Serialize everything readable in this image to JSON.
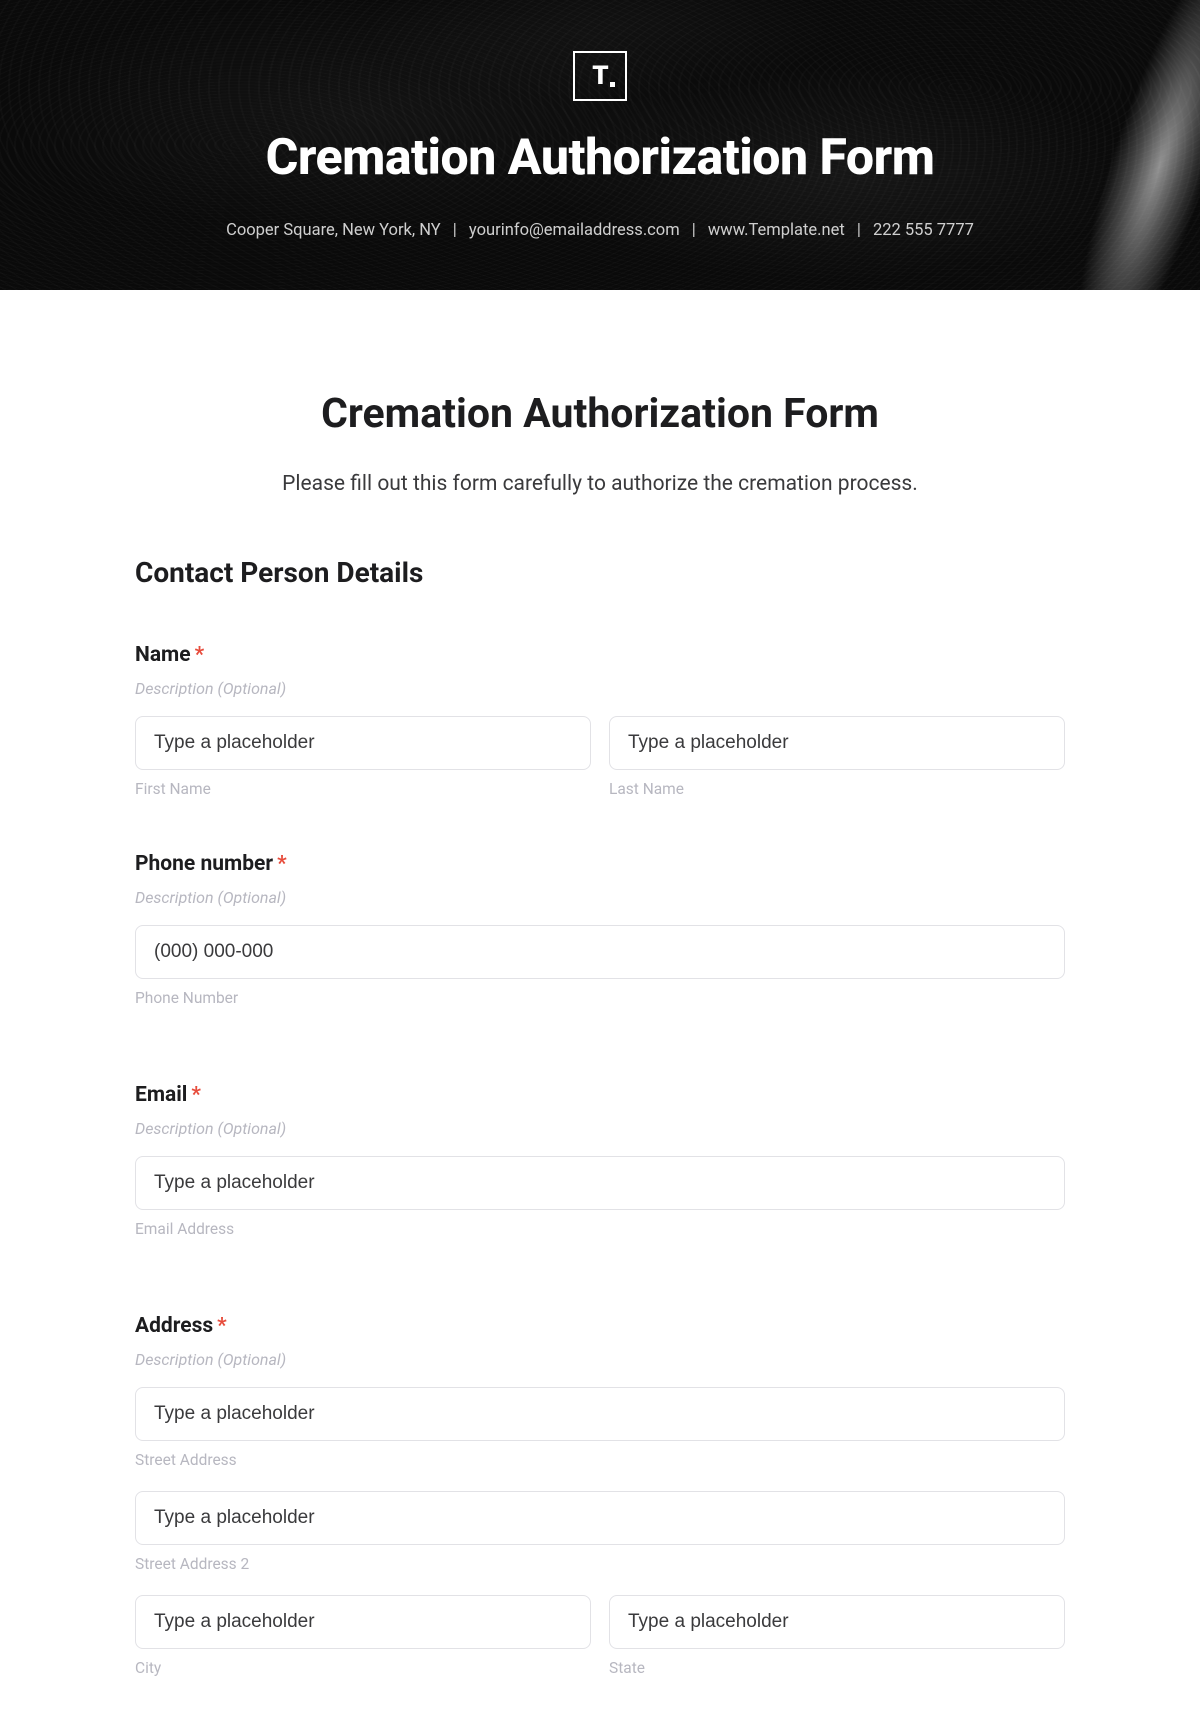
{
  "hero": {
    "logo": "T",
    "title": "Cremation Authorization Form",
    "address": "Cooper Square, New York, NY",
    "email": "yourinfo@emailaddress.com",
    "website": "www.Template.net",
    "phone": "222 555 7777"
  },
  "page": {
    "title": "Cremation Authorization Form",
    "subtitle": "Please fill out this form carefully to authorize the cremation process."
  },
  "section": {
    "title": "Contact Person Details"
  },
  "common": {
    "required_mark": "*",
    "desc_placeholder": "Description (Optional)",
    "input_placeholder": "Type a placeholder"
  },
  "fields": {
    "name": {
      "label": "Name",
      "first_sub": "First Name",
      "last_sub": "Last Name"
    },
    "phone": {
      "label": "Phone number",
      "placeholder": "(000) 000-000",
      "sub": "Phone Number"
    },
    "email": {
      "label": "Email",
      "sub": "Email Address"
    },
    "address": {
      "label": "Address",
      "street1_sub": "Street Address",
      "street2_sub": "Street Address 2",
      "city_sub": "City",
      "state_sub": "State"
    }
  }
}
